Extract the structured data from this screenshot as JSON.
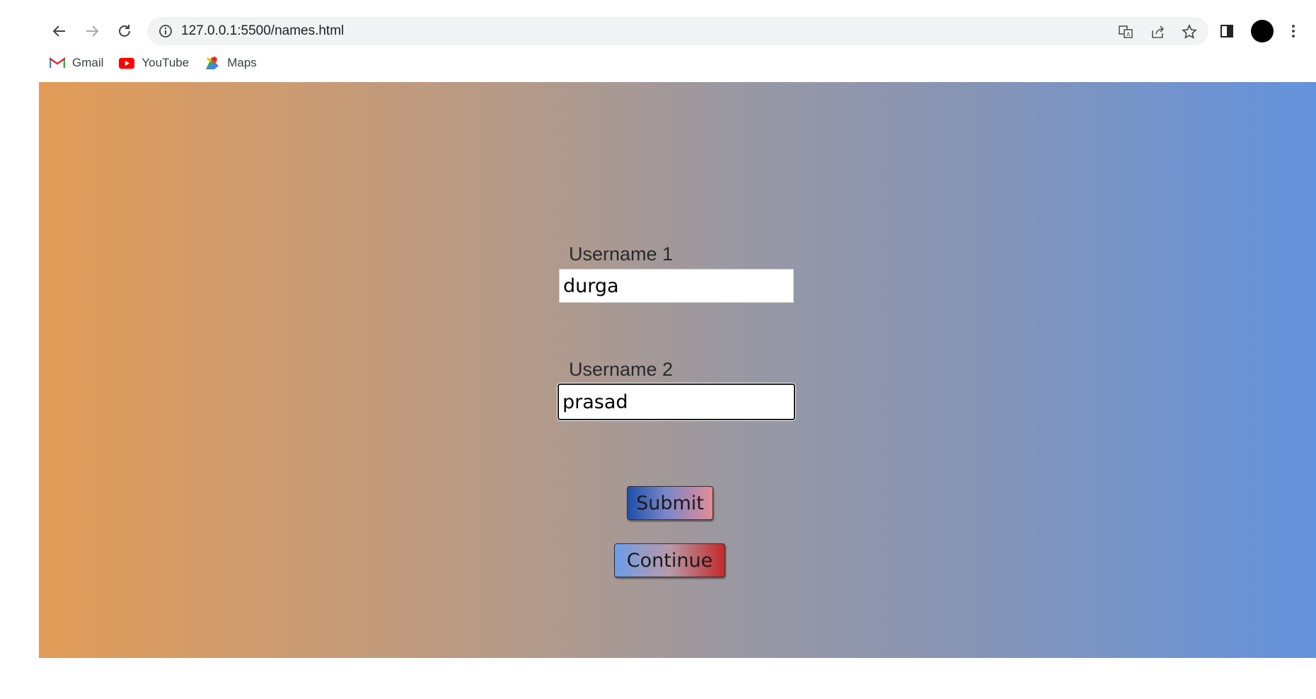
{
  "browser": {
    "url": "127.0.0.1:5500/names.html",
    "bookmarks": [
      {
        "label": "Gmail",
        "icon": "gmail-icon"
      },
      {
        "label": "YouTube",
        "icon": "youtube-icon"
      },
      {
        "label": "Maps",
        "icon": "maps-icon"
      }
    ]
  },
  "form": {
    "username1": {
      "label": "Username 1",
      "value": "durga"
    },
    "username2": {
      "label": "Username 2",
      "value": "prasad"
    },
    "submit_label": "Submit",
    "continue_label": "Continue"
  },
  "colors": {
    "gradient_start": "#e39c58",
    "gradient_end": "#6493de"
  }
}
